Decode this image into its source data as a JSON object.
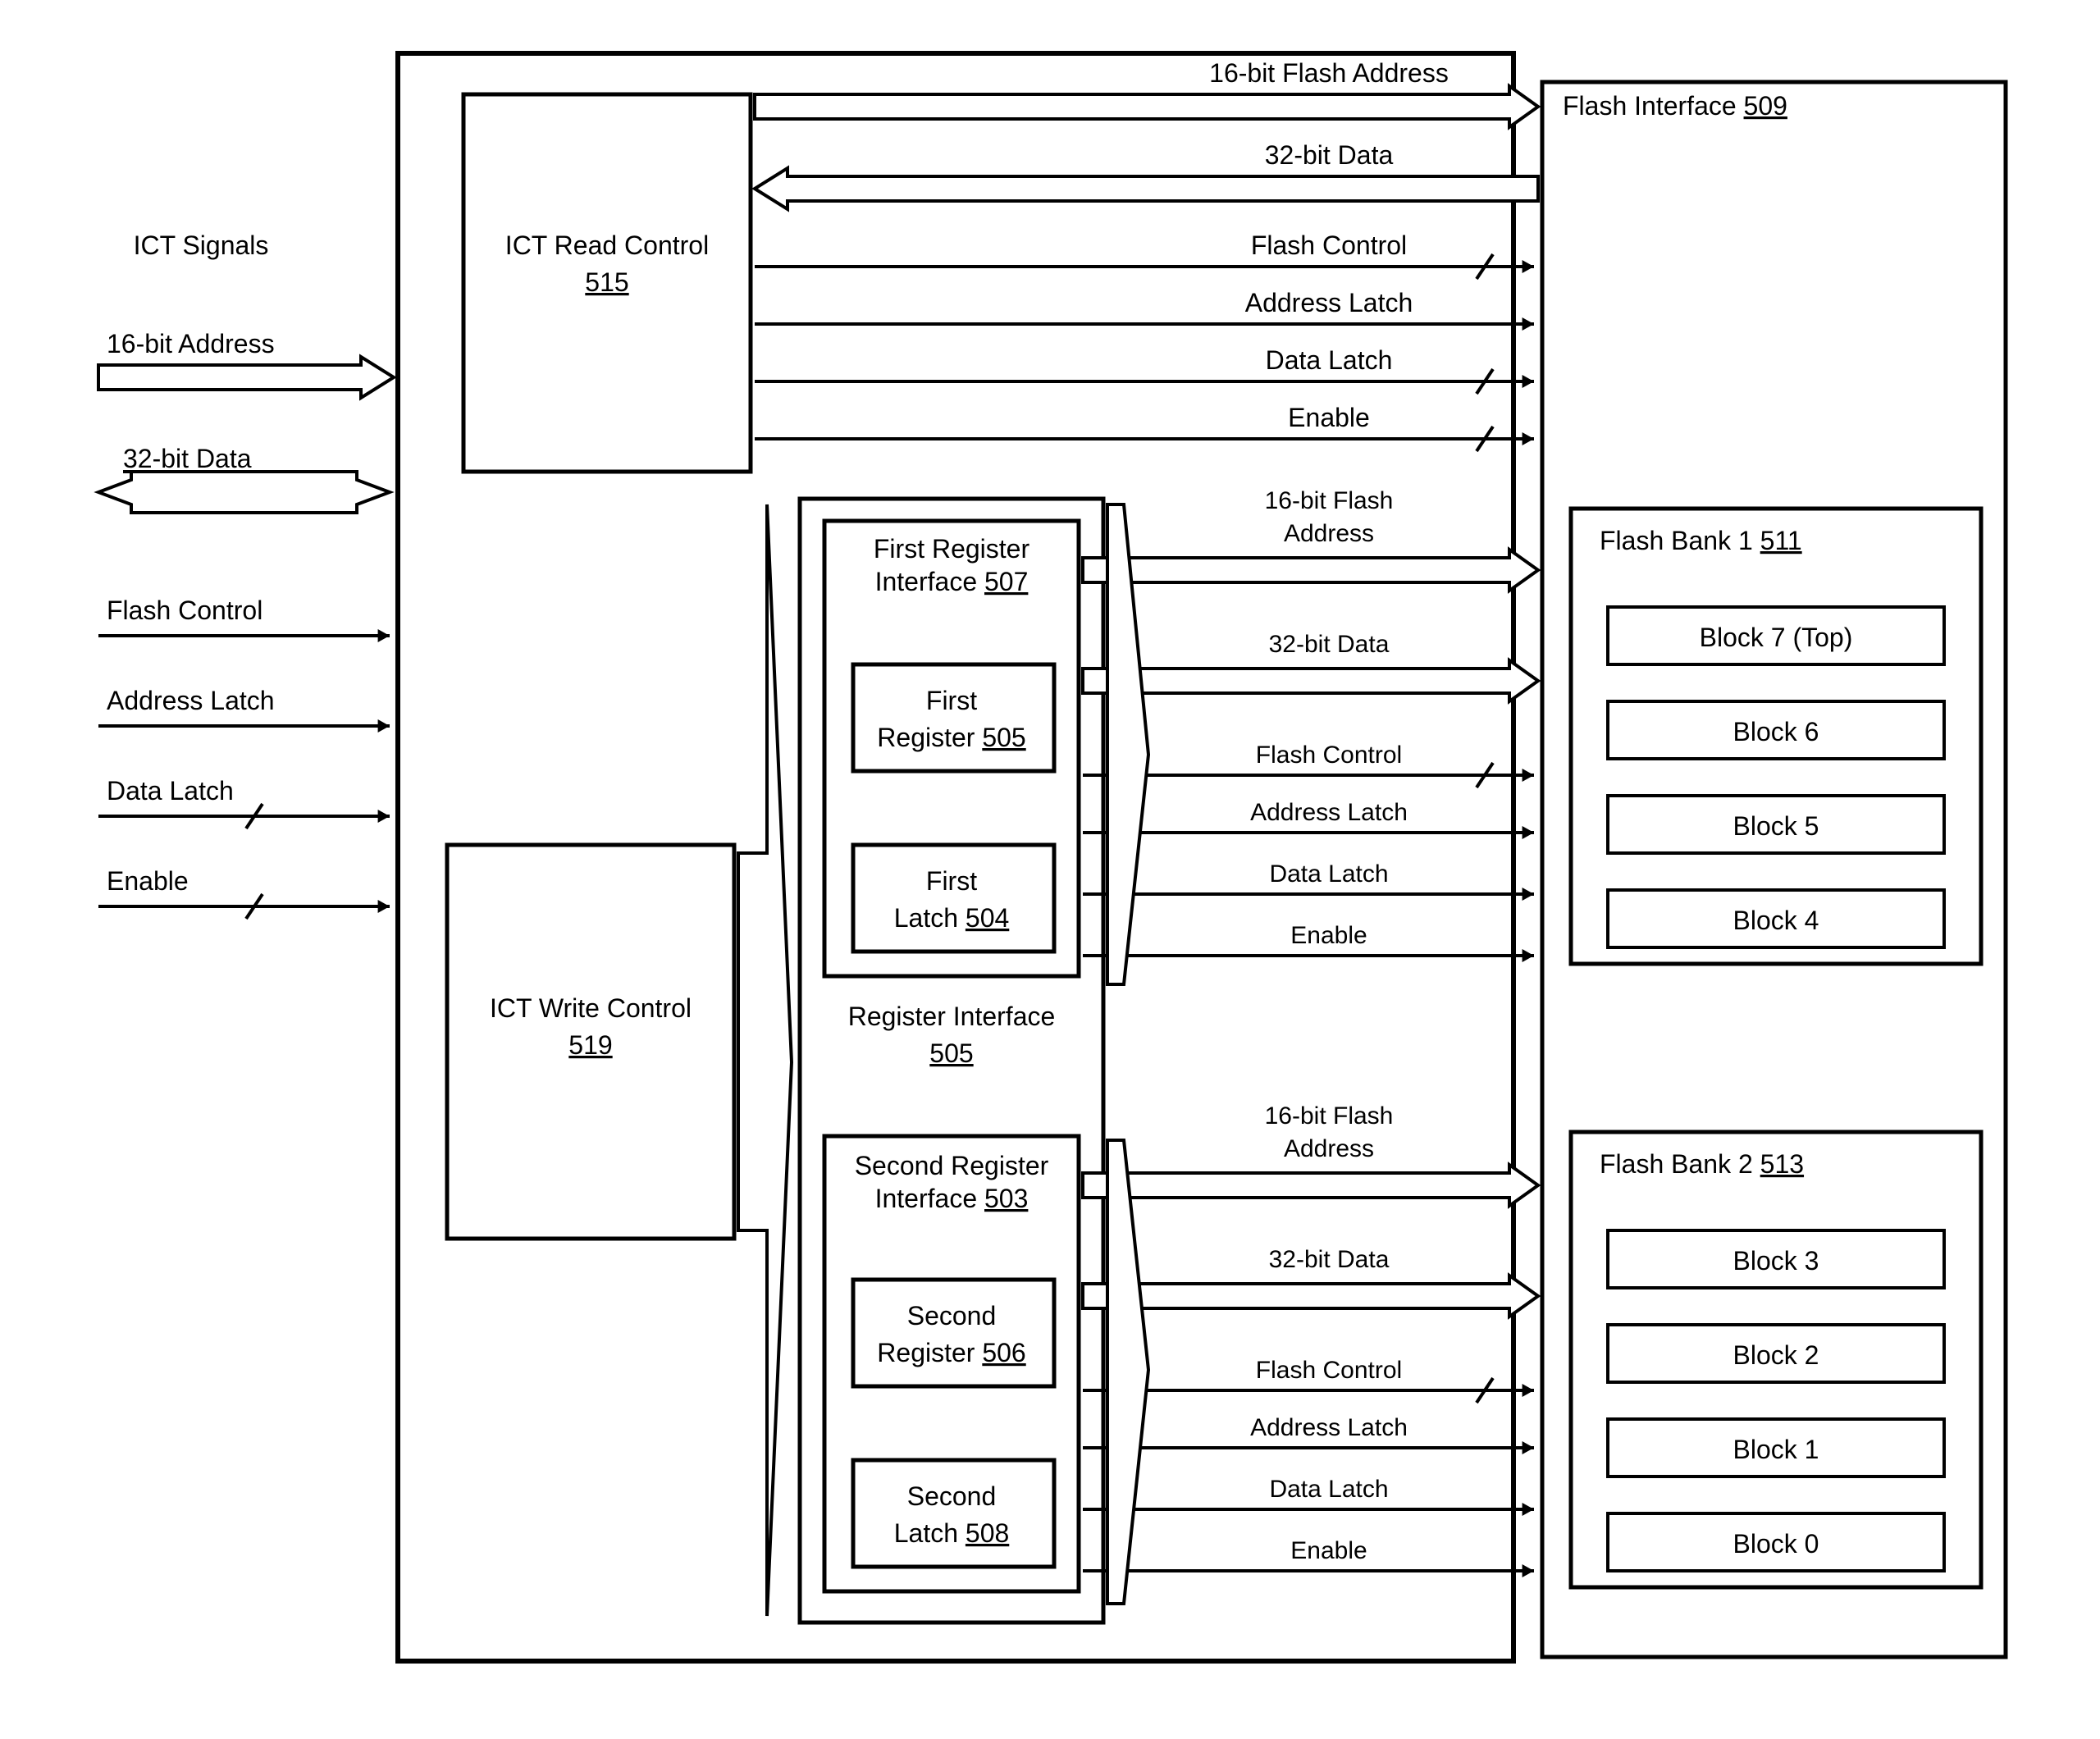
{
  "ext": {
    "title": "ICT Signals",
    "addr": "16-bit Address",
    "data": "32-bit Data",
    "fc": "Flash Control",
    "al": "Address Latch",
    "dl": "Data Latch",
    "en": "Enable"
  },
  "ictRead": {
    "title": "ICT Read Control",
    "ref": "515"
  },
  "ictWrite": {
    "title": "ICT Write Control",
    "ref": "519"
  },
  "topBus": {
    "addr": "16-bit Flash Address",
    "data": "32-bit Data",
    "fc": "Flash Control",
    "al": "Address Latch",
    "dl": "Data Latch",
    "en": "Enable"
  },
  "regIf": {
    "title": "Register Interface",
    "ref": "505"
  },
  "reg1": {
    "title": "First Register",
    "ifTitle": "Interface",
    "ifRef": "507",
    "regTitle1": "First",
    "regTitle2": "Register",
    "regRef": "505",
    "latchTitle1": "First",
    "latchTitle2": "Latch",
    "latchRef": "504"
  },
  "reg2": {
    "title": "Second Register",
    "ifTitle": "Interface",
    "ifRef": "503",
    "regTitle1": "Second",
    "regTitle2": "Register",
    "regRef": "506",
    "latchTitle1": "Second",
    "latchTitle2": "Latch",
    "latchRef": "508"
  },
  "mid": {
    "addr1": "16-bit Flash",
    "addr2": "Address",
    "data": "32-bit Data",
    "fc": "Flash Control",
    "al": "Address Latch",
    "dl": "Data Latch",
    "en": "Enable"
  },
  "flashIf": {
    "title": "Flash Interface",
    "ref": "509"
  },
  "bank1": {
    "title": "Flash Bank 1",
    "ref": "511",
    "blocks": [
      "Block 7 (Top)",
      "Block 6",
      "Block 5",
      "Block 4"
    ]
  },
  "bank2": {
    "title": "Flash Bank 2",
    "ref": "513",
    "blocks": [
      "Block 3",
      "Block 2",
      "Block 1",
      "Block 0"
    ]
  }
}
